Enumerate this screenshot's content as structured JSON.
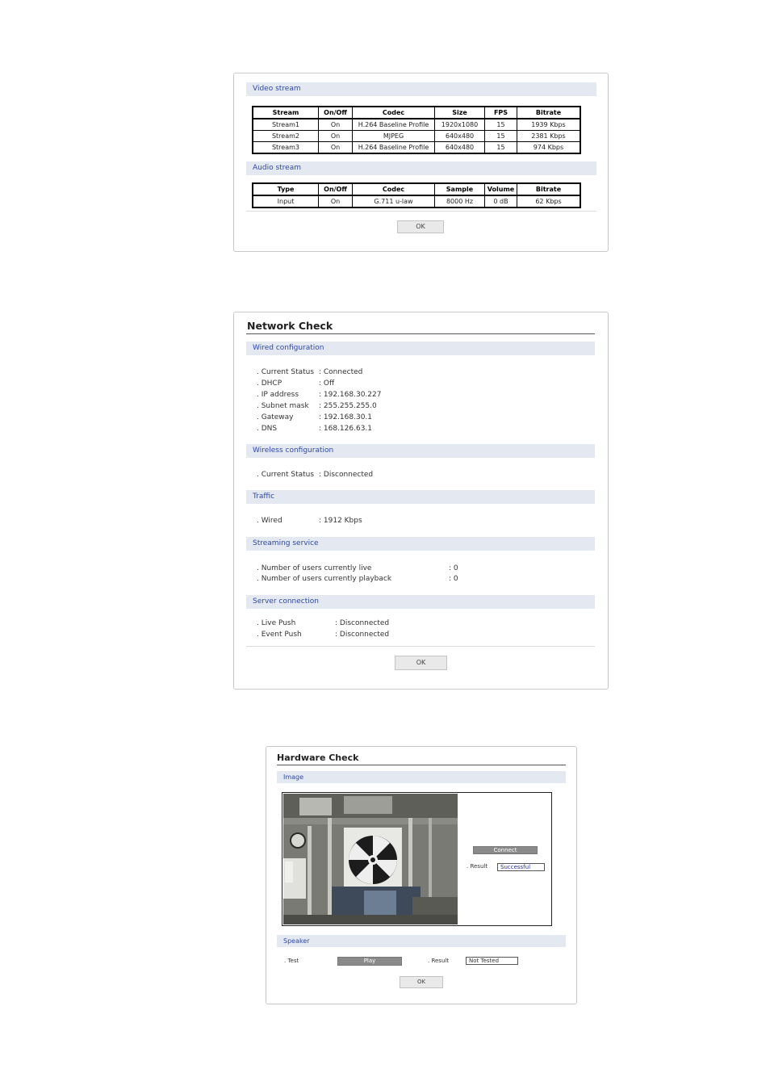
{
  "stream_panel": {
    "video_label": "Video stream",
    "video_headers": [
      "Stream",
      "On/Off",
      "Codec",
      "Size",
      "FPS",
      "Bitrate"
    ],
    "video_rows": [
      [
        "Stream1",
        "On",
        "H.264 Baseline Profile",
        "1920x1080",
        "15",
        "1939 Kbps"
      ],
      [
        "Stream2",
        "On",
        "MJPEG",
        "640x480",
        "15",
        "2381 Kbps"
      ],
      [
        "Stream3",
        "On",
        "H.264 Baseline Profile",
        "640x480",
        "15",
        "974 Kbps"
      ]
    ],
    "audio_label": "Audio stream",
    "audio_headers": [
      "Type",
      "On/Off",
      "Codec",
      "Sample",
      "Volume",
      "Bitrate"
    ],
    "audio_rows": [
      [
        "Input",
        "On",
        "G.711 u-law",
        "8000 Hz",
        "0 dB",
        "62 Kbps"
      ]
    ],
    "ok_label": "OK"
  },
  "network_panel": {
    "title": "Network Check",
    "wired_label": "Wired configuration",
    "wired": [
      {
        "label": ". Current Status",
        "value": ": Connected"
      },
      {
        "label": ". DHCP",
        "value": ": Off"
      },
      {
        "label": ". IP address",
        "value": ": 192.168.30.227"
      },
      {
        "label": ". Subnet mask",
        "value": ": 255.255.255.0"
      },
      {
        "label": ". Gateway",
        "value": ": 192.168.30.1"
      },
      {
        "label": ". DNS",
        "value": ": 168.126.63.1"
      }
    ],
    "wireless_label": "Wireless configuration",
    "wireless": [
      {
        "label": ". Current Status",
        "value": ": Disconnected"
      }
    ],
    "traffic_label": "Traffic",
    "traffic": [
      {
        "label": ". Wired",
        "value": ": 1912 Kbps"
      }
    ],
    "streaming_label": "Streaming service",
    "streaming": [
      {
        "label": ". Number of users currently live",
        "value": ": 0"
      },
      {
        "label": ". Number of users currently playback",
        "value": ": 0"
      }
    ],
    "server_label": "Server connection",
    "server": [
      {
        "label": ". Live Push",
        "value": ": Disconnected"
      },
      {
        "label": ". Event Push",
        "value": ": Disconnected"
      }
    ],
    "ok_label": "OK"
  },
  "hardware_panel": {
    "title": "Hardware Check",
    "image_label": "Image",
    "connect_label": "Connect",
    "result_label": ". Result",
    "image_result": "Successful",
    "speaker_label": "Speaker",
    "test_label": ". Test",
    "play_label": "Play",
    "speaker_result_label": ". Result",
    "speaker_result": "Not Tested",
    "ok_label": "OK"
  },
  "colors": {
    "section_bar": "#e3e8f1",
    "section_text": "#2f49a6",
    "success_text": "#1f2fb0"
  }
}
